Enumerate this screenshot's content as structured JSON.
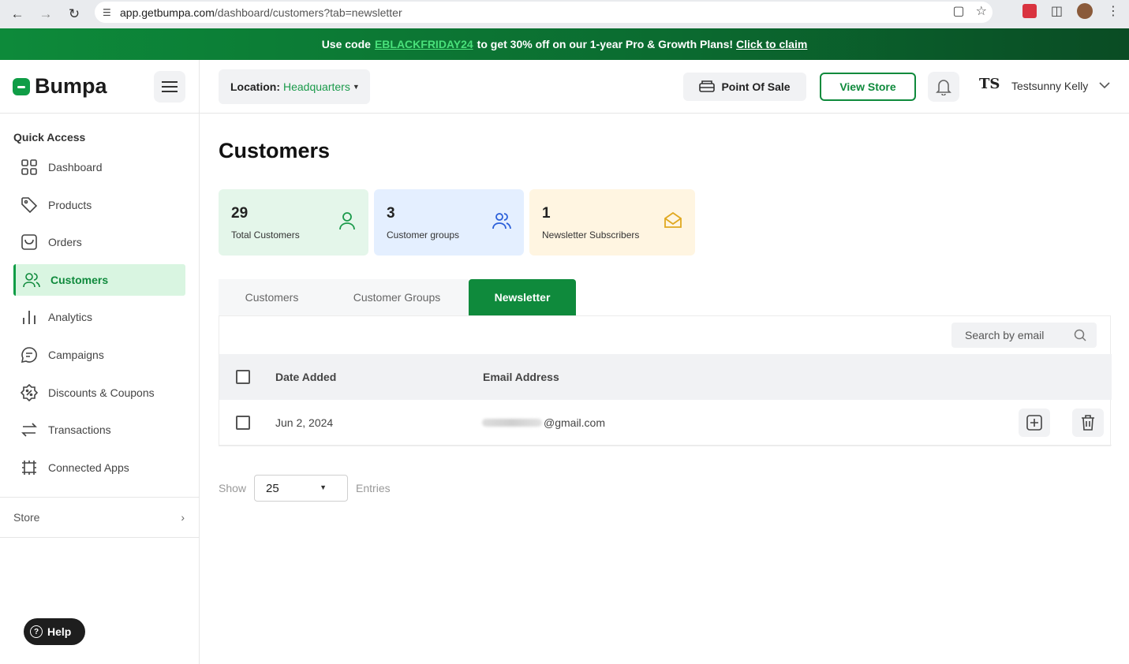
{
  "browser": {
    "url_host": "app.getbumpa.com",
    "url_path": "/dashboard/customers?tab=newsletter"
  },
  "promo": {
    "prefix": "Use code",
    "code": "EBLACKFRIDAY24",
    "middle": "to get 30% off on our 1-year Pro & Growth Plans!",
    "cta": "Click to claim"
  },
  "brand": {
    "name": "Bumpa",
    "color": "#0f9d46"
  },
  "sidebar": {
    "section_title": "Quick Access",
    "items": [
      {
        "label": "Dashboard",
        "icon": "grid-icon"
      },
      {
        "label": "Products",
        "icon": "tag-icon"
      },
      {
        "label": "Orders",
        "icon": "orders-icon"
      },
      {
        "label": "Customers",
        "icon": "users-icon",
        "active": true
      },
      {
        "label": "Analytics",
        "icon": "bar-chart-icon"
      },
      {
        "label": "Campaigns",
        "icon": "chat-icon"
      },
      {
        "label": "Discounts & Coupons",
        "icon": "discount-icon"
      },
      {
        "label": "Transactions",
        "icon": "transfer-icon"
      },
      {
        "label": "Connected Apps",
        "icon": "apps-icon"
      }
    ],
    "store_label": "Store",
    "help_label": "Help"
  },
  "topbar": {
    "location_label": "Location:",
    "location_value": "Headquarters",
    "pos_label": "Point Of Sale",
    "view_store_label": "View Store",
    "avatar_initials": "TS",
    "user_name": "Testsunny Kelly"
  },
  "page": {
    "title": "Customers",
    "stats": [
      {
        "value": "29",
        "label": "Total Customers"
      },
      {
        "value": "3",
        "label": "Customer groups"
      },
      {
        "value": "1",
        "label": "Newsletter Subscribers"
      }
    ],
    "tabs": [
      {
        "label": "Customers"
      },
      {
        "label": "Customer Groups"
      },
      {
        "label": "Newsletter",
        "active": true
      }
    ],
    "search_placeholder": "Search by email",
    "columns": {
      "date": "Date Added",
      "email": "Email Address"
    },
    "rows": [
      {
        "date": "Jun 2, 2024",
        "email_visible": "@gmail.com"
      }
    ],
    "pager": {
      "show_label": "Show",
      "page_size": "25",
      "entries_label": "Entries"
    }
  }
}
